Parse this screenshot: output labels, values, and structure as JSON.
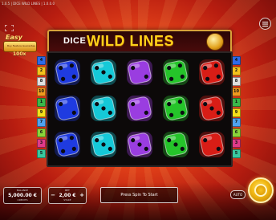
{
  "window_title": "1.0.5 | DICE WILD LINES | 1.0.0.0",
  "header": {
    "fullscreen_icon": "fullscreen-icon",
    "menu_icon": "hamburger-menu-icon"
  },
  "badge": {
    "top": "Easy",
    "sub": "Buy Feature Guarantee",
    "amount": "100x"
  },
  "logo": {
    "word1": "DICE",
    "word2": "WILD LINES"
  },
  "reels": {
    "columns": [
      "blue",
      "cyan",
      "purple",
      "green",
      "red"
    ],
    "rows": 3,
    "faces": [
      [
        4,
        3,
        2,
        4,
        4
      ],
      [
        2,
        3,
        2,
        4,
        3
      ],
      [
        4,
        3,
        3,
        3,
        2
      ]
    ],
    "colors": {
      "blue": "#1f3be0",
      "cyan": "#15c9d8",
      "purple": "#9a3de0",
      "green": "#25c42a",
      "red": "#d81d16"
    }
  },
  "paylines": {
    "left": [
      "4",
      "2",
      "8",
      "10",
      "1",
      "9",
      "7",
      "6",
      "3",
      "5"
    ],
    "right": [
      "4",
      "2",
      "8",
      "10",
      "1",
      "9",
      "7",
      "6",
      "3",
      "5"
    ],
    "colors": [
      "#2e6be8",
      "#f4c21c",
      "#e0e0e0",
      "#f09a1e",
      "#3ab84a",
      "#f4df1a",
      "#4fa3ef",
      "#8ad43a",
      "#e03a8a",
      "#38c9a0"
    ]
  },
  "controls": {
    "balance_label": "BALANCE",
    "balance_value": "5,000.00 €",
    "balance_sub": "CREDITS",
    "bet_label": "BET",
    "bet_value": "2,00 €",
    "bet_sub": "STAKE",
    "bet_minus": "−",
    "bet_plus": "+",
    "message": "Press Spin To Start",
    "auto_label": "AUTO",
    "spin_icon": "spin-button"
  }
}
